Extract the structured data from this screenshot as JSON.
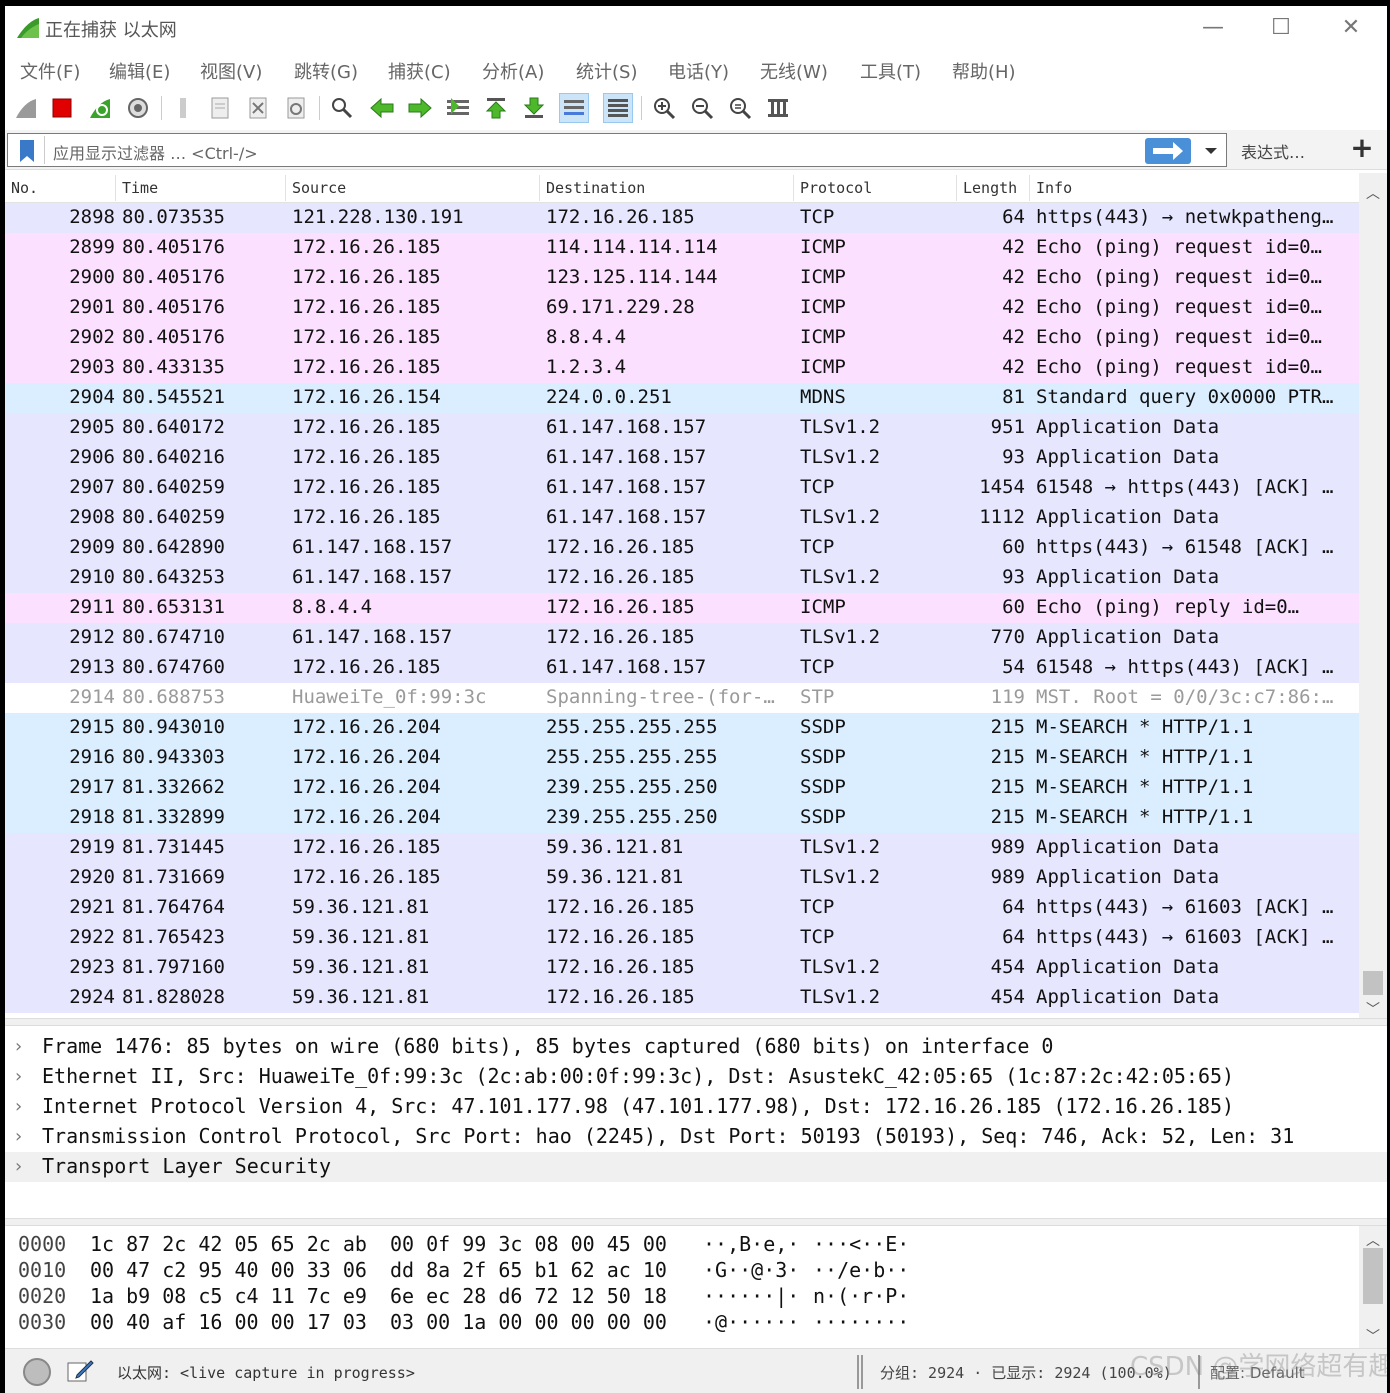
{
  "window": {
    "title": "正在捕获 以太网",
    "controls": [
      "—",
      "☐",
      "✕"
    ]
  },
  "menu": [
    "文件(F)",
    "编辑(E)",
    "视图(V)",
    "跳转(G)",
    "捕获(C)",
    "分析(A)",
    "统计(S)",
    "电话(Y)",
    "无线(W)",
    "工具(T)",
    "帮助(H)"
  ],
  "filter": {
    "placeholder": "应用显示过滤器 … <Ctrl-/>",
    "expression_label": "表达式…",
    "add_label": "+"
  },
  "columns": [
    "No.",
    "Time",
    "Source",
    "Destination",
    "Protocol",
    "Length",
    "Info"
  ],
  "colors": {
    "tcp": "#e7e6ff",
    "icmp": "#fce0ff",
    "udp": "#daeeff",
    "stp": "#ffffff"
  },
  "packets": [
    {
      "no": "2898",
      "time": "80.073535",
      "src": "121.228.130.191",
      "dst": "172.16.26.185",
      "proto": "TCP",
      "len": "64",
      "info": "https(443) → netwkpatheng…",
      "kind": "tcp"
    },
    {
      "no": "2899",
      "time": "80.405176",
      "src": "172.16.26.185",
      "dst": "114.114.114.114",
      "proto": "ICMP",
      "len": "42",
      "info": "Echo (ping) request  id=0…",
      "kind": "icmp"
    },
    {
      "no": "2900",
      "time": "80.405176",
      "src": "172.16.26.185",
      "dst": "123.125.114.144",
      "proto": "ICMP",
      "len": "42",
      "info": "Echo (ping) request  id=0…",
      "kind": "icmp"
    },
    {
      "no": "2901",
      "time": "80.405176",
      "src": "172.16.26.185",
      "dst": "69.171.229.28",
      "proto": "ICMP",
      "len": "42",
      "info": "Echo (ping) request  id=0…",
      "kind": "icmp"
    },
    {
      "no": "2902",
      "time": "80.405176",
      "src": "172.16.26.185",
      "dst": "8.8.4.4",
      "proto": "ICMP",
      "len": "42",
      "info": "Echo (ping) request  id=0…",
      "kind": "icmp"
    },
    {
      "no": "2903",
      "time": "80.433135",
      "src": "172.16.26.185",
      "dst": "1.2.3.4",
      "proto": "ICMP",
      "len": "42",
      "info": "Echo (ping) request  id=0…",
      "kind": "icmp"
    },
    {
      "no": "2904",
      "time": "80.545521",
      "src": "172.16.26.154",
      "dst": "224.0.0.251",
      "proto": "MDNS",
      "len": "81",
      "info": "Standard query 0x0000 PTR…",
      "kind": "udp"
    },
    {
      "no": "2905",
      "time": "80.640172",
      "src": "172.16.26.185",
      "dst": "61.147.168.157",
      "proto": "TLSv1.2",
      "len": "951",
      "info": "Application Data",
      "kind": "tcp"
    },
    {
      "no": "2906",
      "time": "80.640216",
      "src": "172.16.26.185",
      "dst": "61.147.168.157",
      "proto": "TLSv1.2",
      "len": "93",
      "info": "Application Data",
      "kind": "tcp"
    },
    {
      "no": "2907",
      "time": "80.640259",
      "src": "172.16.26.185",
      "dst": "61.147.168.157",
      "proto": "TCP",
      "len": "1454",
      "info": "61548 → https(443) [ACK] …",
      "kind": "tcp"
    },
    {
      "no": "2908",
      "time": "80.640259",
      "src": "172.16.26.185",
      "dst": "61.147.168.157",
      "proto": "TLSv1.2",
      "len": "1112",
      "info": "Application Data",
      "kind": "tcp"
    },
    {
      "no": "2909",
      "time": "80.642890",
      "src": "61.147.168.157",
      "dst": "172.16.26.185",
      "proto": "TCP",
      "len": "60",
      "info": "https(443) → 61548 [ACK] …",
      "kind": "tcp"
    },
    {
      "no": "2910",
      "time": "80.643253",
      "src": "61.147.168.157",
      "dst": "172.16.26.185",
      "proto": "TLSv1.2",
      "len": "93",
      "info": "Application Data",
      "kind": "tcp"
    },
    {
      "no": "2911",
      "time": "80.653131",
      "src": "8.8.4.4",
      "dst": "172.16.26.185",
      "proto": "ICMP",
      "len": "60",
      "info": "Echo (ping) reply    id=0…",
      "kind": "icmp"
    },
    {
      "no": "2912",
      "time": "80.674710",
      "src": "61.147.168.157",
      "dst": "172.16.26.185",
      "proto": "TLSv1.2",
      "len": "770",
      "info": "Application Data",
      "kind": "tcp"
    },
    {
      "no": "2913",
      "time": "80.674760",
      "src": "172.16.26.185",
      "dst": "61.147.168.157",
      "proto": "TCP",
      "len": "54",
      "info": "61548 → https(443) [ACK] …",
      "kind": "tcp"
    },
    {
      "no": "2914",
      "time": "80.688753",
      "src": "HuaweiTe_0f:99:3c",
      "dst": "Spanning-tree-(for-…",
      "proto": "STP",
      "len": "119",
      "info": "MST. Root = 0/0/3c:c7:86:…",
      "kind": "stp"
    },
    {
      "no": "2915",
      "time": "80.943010",
      "src": "172.16.26.204",
      "dst": "255.255.255.255",
      "proto": "SSDP",
      "len": "215",
      "info": "M-SEARCH * HTTP/1.1",
      "kind": "udp"
    },
    {
      "no": "2916",
      "time": "80.943303",
      "src": "172.16.26.204",
      "dst": "255.255.255.255",
      "proto": "SSDP",
      "len": "215",
      "info": "M-SEARCH * HTTP/1.1",
      "kind": "udp"
    },
    {
      "no": "2917",
      "time": "81.332662",
      "src": "172.16.26.204",
      "dst": "239.255.255.250",
      "proto": "SSDP",
      "len": "215",
      "info": "M-SEARCH * HTTP/1.1",
      "kind": "udp"
    },
    {
      "no": "2918",
      "time": "81.332899",
      "src": "172.16.26.204",
      "dst": "239.255.255.250",
      "proto": "SSDP",
      "len": "215",
      "info": "M-SEARCH * HTTP/1.1",
      "kind": "udp"
    },
    {
      "no": "2919",
      "time": "81.731445",
      "src": "172.16.26.185",
      "dst": "59.36.121.81",
      "proto": "TLSv1.2",
      "len": "989",
      "info": "Application Data",
      "kind": "tcp"
    },
    {
      "no": "2920",
      "time": "81.731669",
      "src": "172.16.26.185",
      "dst": "59.36.121.81",
      "proto": "TLSv1.2",
      "len": "989",
      "info": "Application Data",
      "kind": "tcp"
    },
    {
      "no": "2921",
      "time": "81.764764",
      "src": "59.36.121.81",
      "dst": "172.16.26.185",
      "proto": "TCP",
      "len": "64",
      "info": "https(443) → 61603 [ACK] …",
      "kind": "tcp"
    },
    {
      "no": "2922",
      "time": "81.765423",
      "src": "59.36.121.81",
      "dst": "172.16.26.185",
      "proto": "TCP",
      "len": "64",
      "info": "https(443) → 61603 [ACK] …",
      "kind": "tcp"
    },
    {
      "no": "2923",
      "time": "81.797160",
      "src": "59.36.121.81",
      "dst": "172.16.26.185",
      "proto": "TLSv1.2",
      "len": "454",
      "info": "Application Data",
      "kind": "tcp"
    },
    {
      "no": "2924",
      "time": "81.828028",
      "src": "59.36.121.81",
      "dst": "172.16.26.185",
      "proto": "TLSv1.2",
      "len": "454",
      "info": "Application Data",
      "kind": "tcp"
    }
  ],
  "details": [
    "Frame 1476: 85 bytes on wire (680 bits), 85 bytes captured (680 bits) on interface 0",
    "Ethernet II, Src: HuaweiTe_0f:99:3c (2c:ab:00:0f:99:3c), Dst: AsustekC_42:05:65 (1c:87:2c:42:05:65)",
    "Internet Protocol Version 4, Src: 47.101.177.98 (47.101.177.98), Dst: 172.16.26.185 (172.16.26.185)",
    "Transmission Control Protocol, Src Port: hao (2245), Dst Port: 50193 (50193), Seq: 746, Ack: 52, Len: 31",
    "Transport Layer Security"
  ],
  "bytes": [
    {
      "offset": "0000",
      "hex1": "1c 87 2c 42 05 65 2c ab",
      "hex2": "00 0f 99 3c 08 00 45 00",
      "ascii1": "··,B·e,·",
      "ascii2": "···<··E·"
    },
    {
      "offset": "0010",
      "hex1": "00 47 c2 95 40 00 33 06",
      "hex2": "dd 8a 2f 65 b1 62 ac 10",
      "ascii1": "·G··@·3·",
      "ascii2": "··/e·b··"
    },
    {
      "offset": "0020",
      "hex1": "1a b9 08 c5 c4 11 7c e9",
      "hex2": "6e ec 28 d6 72 12 50 18",
      "ascii1": "······|·",
      "ascii2": "n·(·r·P·"
    },
    {
      "offset": "0030",
      "hex1": "00 40 af 16 00 00 17 03",
      "hex2": "03 00 1a 00 00 00 00 00",
      "ascii1": "·@······",
      "ascii2": "········"
    }
  ],
  "status": {
    "capture": "以太网: <live capture in progress>",
    "counts": "分组: 2924 · 已显示: 2924 (100.0%)",
    "profile": "配置: Default",
    "watermark": "CSDN @学网络超有趣"
  },
  "icons": {
    "toolbar": [
      "shark-fin-start-icon",
      "stop-capture-icon",
      "restart-capture-icon",
      "capture-options-icon",
      "open-file-icon",
      "save-file-icon",
      "close-file-icon",
      "reload-file-icon",
      "find-packet-icon",
      "go-back-icon",
      "go-forward-icon",
      "go-to-packet-icon",
      "go-first-icon",
      "go-last-icon",
      "auto-scroll-icon",
      "colorize-icon",
      "zoom-in-icon",
      "zoom-out-icon",
      "zoom-reset-icon",
      "resize-columns-icon"
    ]
  }
}
